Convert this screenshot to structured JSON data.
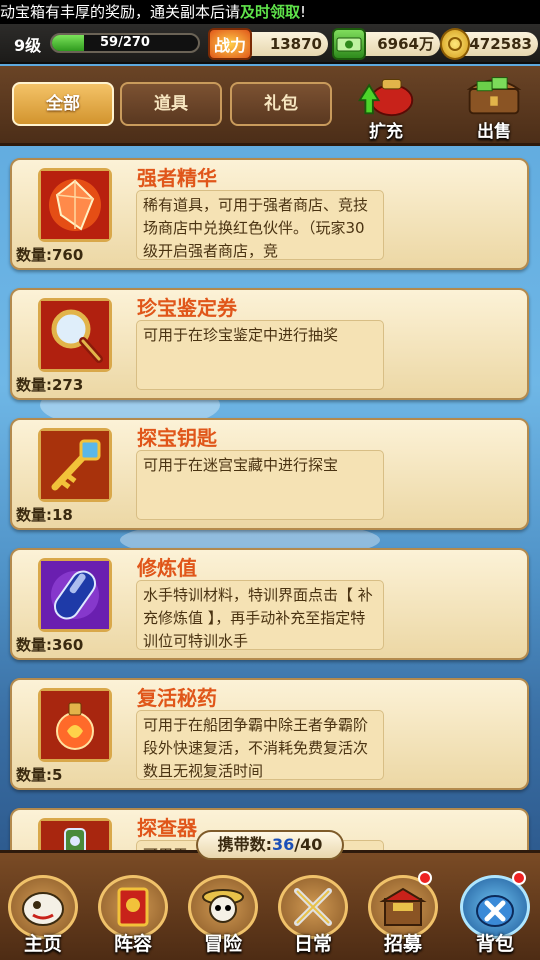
{
  "marquee": {
    "text_a": "动宝箱有丰厚的奖励，通关副本后请",
    "text_b": "及时领取",
    "text_c": "!"
  },
  "status": {
    "level": "9级",
    "exp_text": "59/270",
    "exp_fraction": 0.2185,
    "power_label": "战力",
    "power": "13870",
    "cash": "6964万",
    "gold": "472583"
  },
  "tabs": [
    {
      "label": "全部",
      "active": true
    },
    {
      "label": "道具",
      "active": false
    },
    {
      "label": "礼包",
      "active": false
    }
  ],
  "header_buttons": {
    "expand": "扩充",
    "sell": "出售"
  },
  "items": [
    {
      "name": "强者精华",
      "qty": "数量:760",
      "icon": "crystal-icon",
      "desc": "稀有道具，可用于强者商店、竞技场商店中兑换红色伙伴。（玩家30级开启强者商店，竞"
    },
    {
      "name": "珍宝鉴定券",
      "qty": "数量:273",
      "icon": "magnifier-icon",
      "desc": "可用于在珍宝鉴定中进行抽奖"
    },
    {
      "name": "探宝钥匙",
      "qty": "数量:18",
      "icon": "key-icon",
      "desc": "可用于在迷宫宝藏中进行探宝"
    },
    {
      "name": "修炼值",
      "qty": "数量:360",
      "icon": "capsule-icon",
      "desc": "水手特训材料，特训界面点击【 补充修炼值 】，再手动补充至指定特训位可特训水手"
    },
    {
      "name": "复活秘药",
      "qty": "数量:5",
      "icon": "potion-icon",
      "desc": "可用于在船团争霸中除王者争霸阶段外快速复活，不消耗免费复活次数且无视复活时间"
    },
    {
      "name": "探查器",
      "qty": "",
      "icon": "detector-icon",
      "desc": "可用于…"
    }
  ],
  "carry": {
    "label": "携带数:",
    "current": "36",
    "max": "/40"
  },
  "nav": [
    {
      "label": "主页",
      "icon": "home-icon"
    },
    {
      "label": "阵容",
      "icon": "lineup-icon"
    },
    {
      "label": "冒险",
      "icon": "skull-icon"
    },
    {
      "label": "日常",
      "icon": "swords-icon"
    },
    {
      "label": "招募",
      "icon": "tavern-icon"
    },
    {
      "label": "背包",
      "icon": "bag-icon"
    }
  ],
  "colors": {
    "item_name": "#e0561a",
    "accent_gold": "#d9a84a",
    "exp_green": "#4fc22e"
  }
}
